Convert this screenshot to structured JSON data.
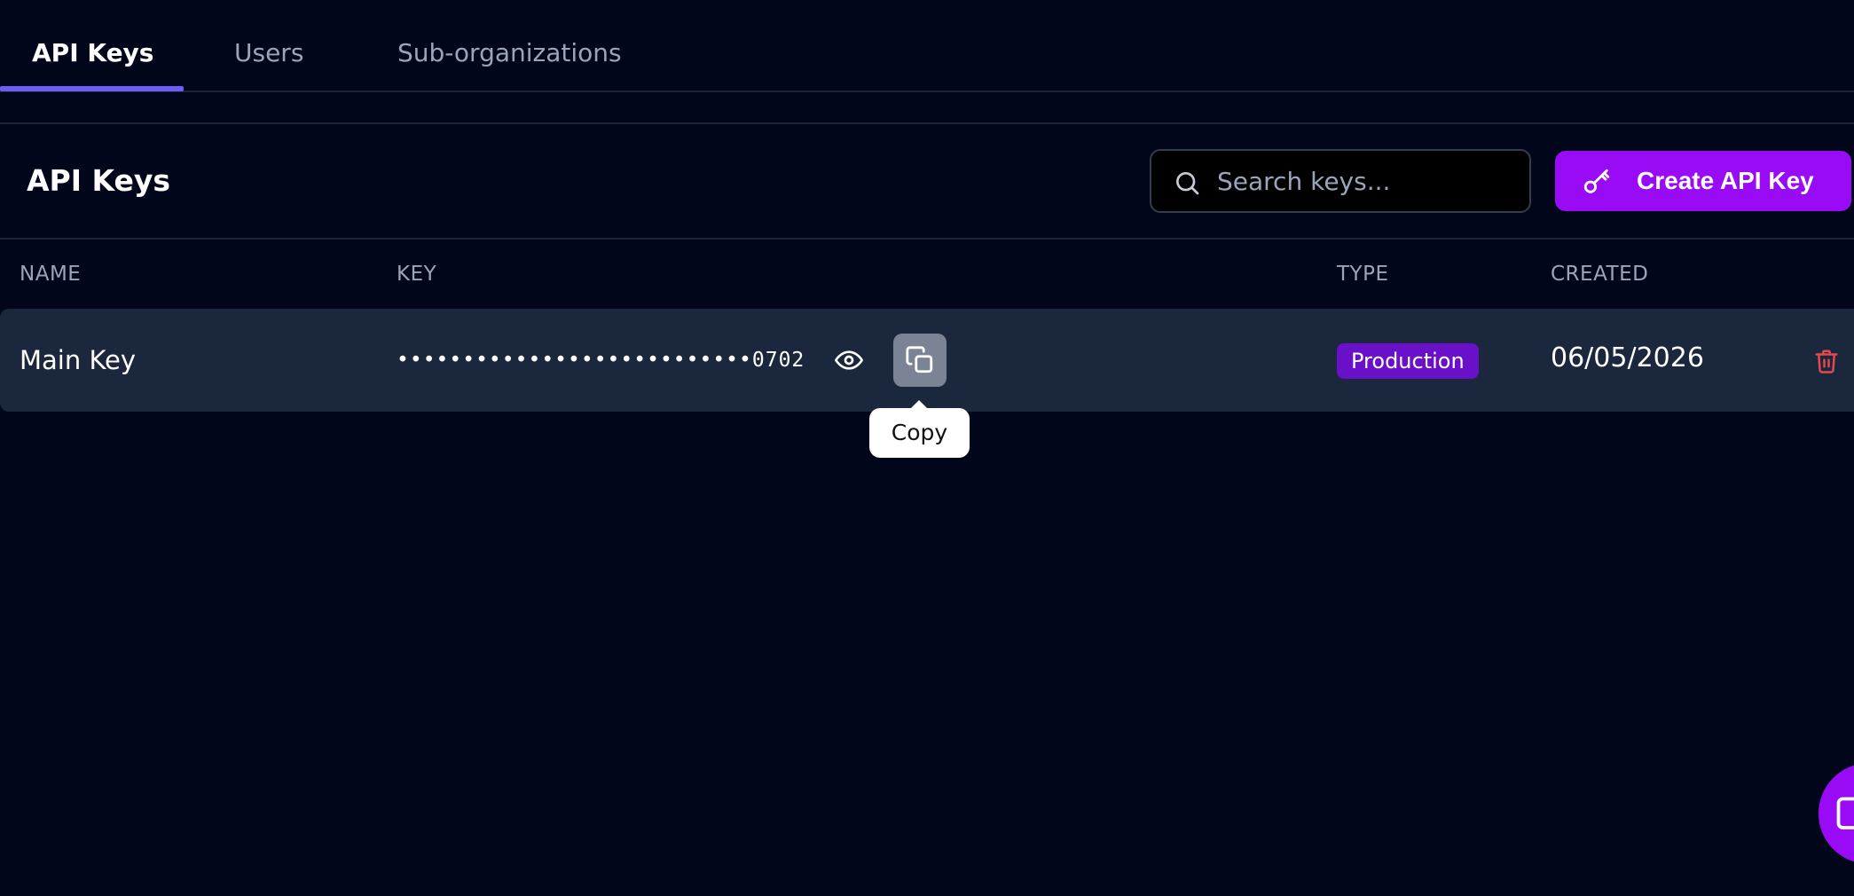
{
  "tabs": [
    {
      "label": "API Keys",
      "active": true
    },
    {
      "label": "Users",
      "active": false
    },
    {
      "label": "Sub-organizations",
      "active": false
    }
  ],
  "section": {
    "title": "API Keys"
  },
  "search": {
    "placeholder": "Search keys...",
    "value": "",
    "icon": "search-icon"
  },
  "create_button": {
    "label": "Create API Key",
    "icon": "key-icon"
  },
  "table": {
    "columns": [
      "NAME",
      "KEY",
      "TYPE",
      "CREATED"
    ],
    "rows": [
      {
        "name": "Main Key",
        "key": "•••••••••••••••••••••••••••0702",
        "type": "Production",
        "created": "06/05/2026"
      }
    ]
  },
  "tooltip": {
    "text": "Copy"
  },
  "colors": {
    "background": "#02061a",
    "accent": "#9a0bf5",
    "tab_underline": "#6d5cf5",
    "row_background": "#1b273c",
    "badge": "#6a10c9",
    "delete": "#e5484d"
  }
}
